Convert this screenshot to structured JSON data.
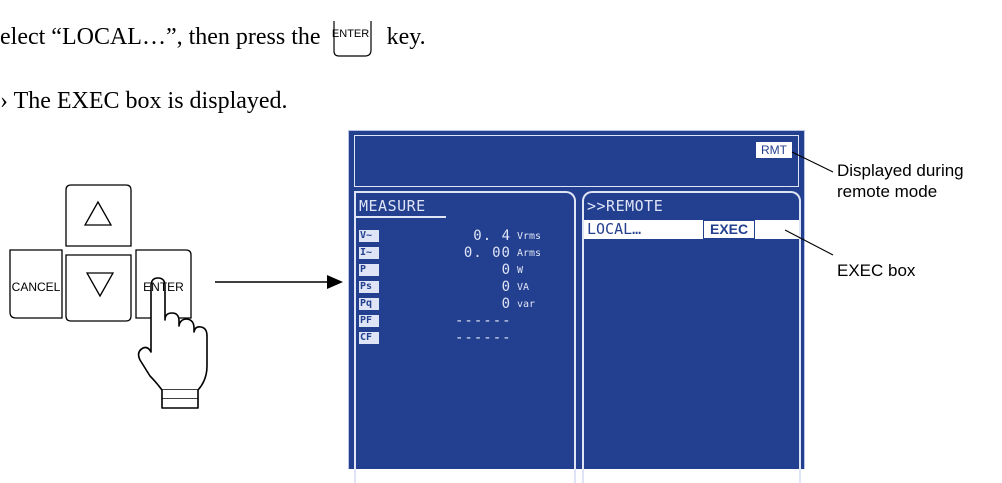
{
  "instructions": {
    "step_text_before": "elect “LOCAL…”, then press the",
    "step_key_label": "ENTER",
    "step_text_after": "key.",
    "result_arrow": "›",
    "result_text": "The EXEC box is displayed."
  },
  "keypad": {
    "cancel_label": "CANCEL",
    "enter_label": "ENTER",
    "up_glyph": "△",
    "down_glyph": "▽"
  },
  "screen": {
    "rmt_label": "RMT",
    "measure_title": "MEASURE",
    "remote_title": ">>REMOTE",
    "local_label": "LOCAL…",
    "exec_label": "EXEC",
    "measurements": [
      {
        "tag": "V~",
        "value": "0. 4",
        "unit": "Vrms"
      },
      {
        "tag": "I~",
        "value": "0. 00",
        "unit": "Arms"
      },
      {
        "tag": "P",
        "value": "0",
        "unit": "W"
      },
      {
        "tag": "Ps",
        "value": "0",
        "unit": "VA"
      },
      {
        "tag": "Pq",
        "value": "0",
        "unit": "var"
      },
      {
        "tag": "PF",
        "value": "------",
        "unit": ""
      },
      {
        "tag": "CF",
        "value": "------",
        "unit": ""
      }
    ]
  },
  "callouts": {
    "rmt_line1": "Displayed during",
    "rmt_line2": "remote mode",
    "exec": "EXEC box"
  }
}
